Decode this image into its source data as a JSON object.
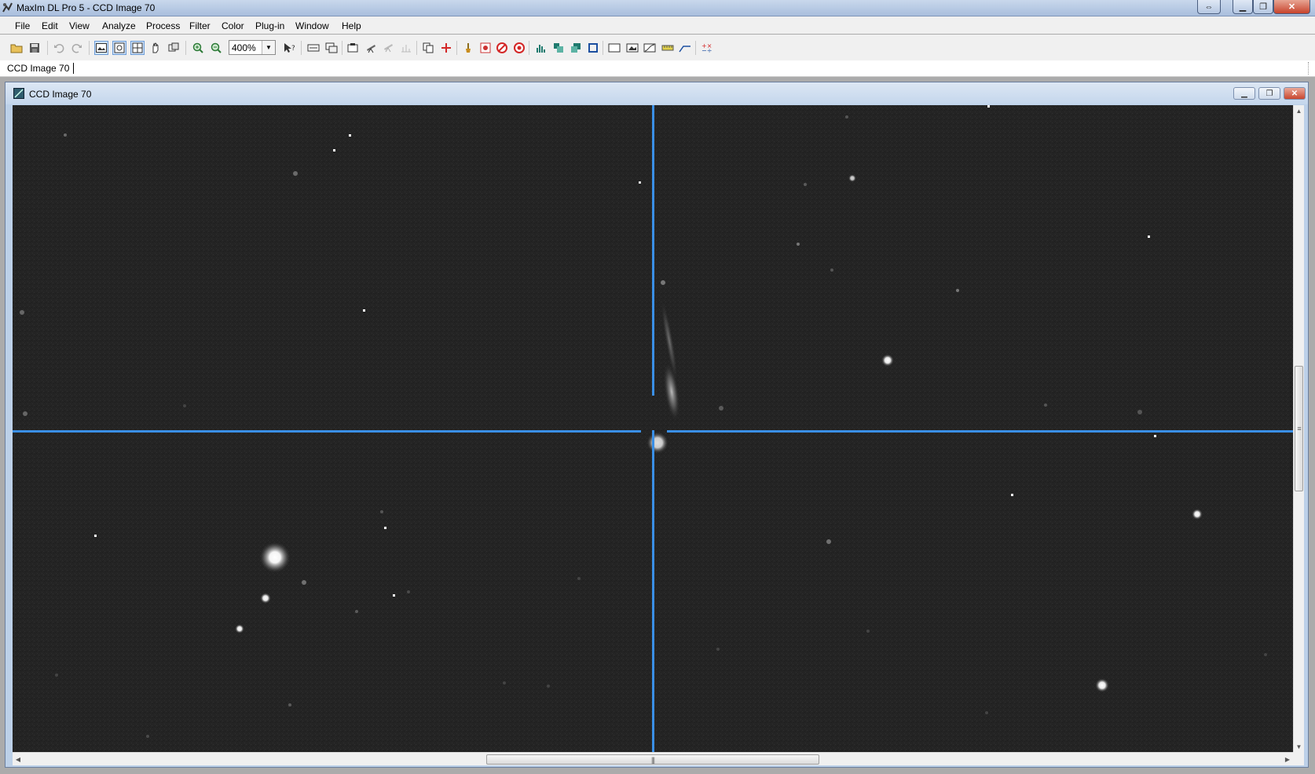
{
  "window": {
    "title": "MaxIm DL Pro 5 - CCD Image 70"
  },
  "menu": [
    "File",
    "Edit",
    "View",
    "Analyze",
    "Process",
    "Filter",
    "Color",
    "Plug-in",
    "Window",
    "Help"
  ],
  "toolbar": {
    "zoom_value": "400%"
  },
  "document_bar": {
    "label": "CCD Image 70"
  },
  "image_window": {
    "title": "CCD Image 70",
    "crosshair_color": "#3a8fe6"
  }
}
